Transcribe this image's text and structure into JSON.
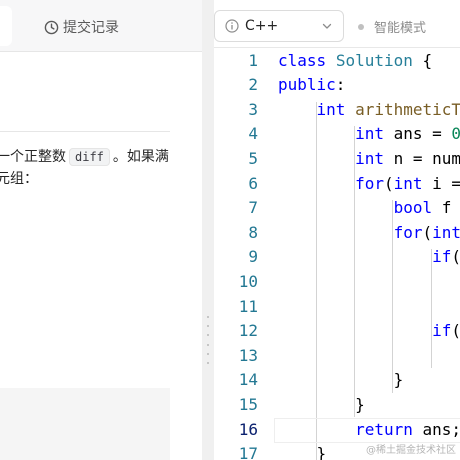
{
  "left_panel": {
    "submissions_tab_label": "提交记录",
    "description": {
      "line1_before": "一个正整数",
      "line1_code": "diff",
      "line1_after": "。如果满",
      "line2": "元组："
    }
  },
  "editor": {
    "language": {
      "selected": "C++",
      "icon": "info-icon",
      "dropdown_icon": "chevron-down-icon"
    },
    "smart_mode_label": "智能模式",
    "current_line": 16,
    "code_lines": [
      {
        "number": "1",
        "tokens": [
          {
            "t": "kw",
            "v": "class"
          },
          {
            "t": "tx",
            "v": " "
          },
          {
            "t": "ty",
            "v": "Solution"
          },
          {
            "t": "tx",
            "v": " {"
          }
        ]
      },
      {
        "number": "2",
        "tokens": [
          {
            "t": "kw",
            "v": "public"
          },
          {
            "t": "tx",
            "v": ":"
          }
        ]
      },
      {
        "number": "3",
        "tokens": [
          {
            "t": "tx",
            "v": "    "
          },
          {
            "t": "kw",
            "v": "int"
          },
          {
            "t": "tx",
            "v": " "
          },
          {
            "t": "fn",
            "v": "arithmeticT"
          }
        ]
      },
      {
        "number": "4",
        "tokens": [
          {
            "t": "tx",
            "v": "        "
          },
          {
            "t": "kw",
            "v": "int"
          },
          {
            "t": "tx",
            "v": " ans = "
          },
          {
            "t": "nm",
            "v": "0"
          }
        ]
      },
      {
        "number": "5",
        "tokens": [
          {
            "t": "tx",
            "v": "        "
          },
          {
            "t": "kw",
            "v": "int"
          },
          {
            "t": "tx",
            "v": " n = num"
          }
        ]
      },
      {
        "number": "6",
        "tokens": [
          {
            "t": "tx",
            "v": "        "
          },
          {
            "t": "kw",
            "v": "for"
          },
          {
            "t": "tx",
            "v": "("
          },
          {
            "t": "kw",
            "v": "int"
          },
          {
            "t": "tx",
            "v": " i ="
          }
        ]
      },
      {
        "number": "7",
        "tokens": [
          {
            "t": "tx",
            "v": "            "
          },
          {
            "t": "kw",
            "v": "bool"
          },
          {
            "t": "tx",
            "v": " f"
          }
        ]
      },
      {
        "number": "8",
        "tokens": [
          {
            "t": "tx",
            "v": "            "
          },
          {
            "t": "kw",
            "v": "for"
          },
          {
            "t": "tx",
            "v": "("
          },
          {
            "t": "kw",
            "v": "int"
          }
        ]
      },
      {
        "number": "9",
        "tokens": [
          {
            "t": "tx",
            "v": "                "
          },
          {
            "t": "kw",
            "v": "if"
          },
          {
            "t": "tx",
            "v": "("
          }
        ]
      },
      {
        "number": "10",
        "tokens": []
      },
      {
        "number": "11",
        "tokens": []
      },
      {
        "number": "12",
        "tokens": [
          {
            "t": "tx",
            "v": "                "
          },
          {
            "t": "kw",
            "v": "if"
          },
          {
            "t": "tx",
            "v": "("
          }
        ]
      },
      {
        "number": "13",
        "tokens": []
      },
      {
        "number": "14",
        "tokens": [
          {
            "t": "tx",
            "v": "            }"
          }
        ]
      },
      {
        "number": "15",
        "tokens": [
          {
            "t": "tx",
            "v": "        }"
          }
        ]
      },
      {
        "number": "16",
        "tokens": [
          {
            "t": "tx",
            "v": "        "
          },
          {
            "t": "kw",
            "v": "return"
          },
          {
            "t": "tx",
            "v": " ans;"
          }
        ]
      },
      {
        "number": "17",
        "tokens": [
          {
            "t": "tx",
            "v": "    }"
          }
        ]
      }
    ]
  },
  "watermark": "@稀土掘金技术社区",
  "colors": {
    "keyword": "#0000ff",
    "type": "#267f99",
    "function": "#795e26",
    "number": "#098658",
    "line_number": "#237893"
  }
}
